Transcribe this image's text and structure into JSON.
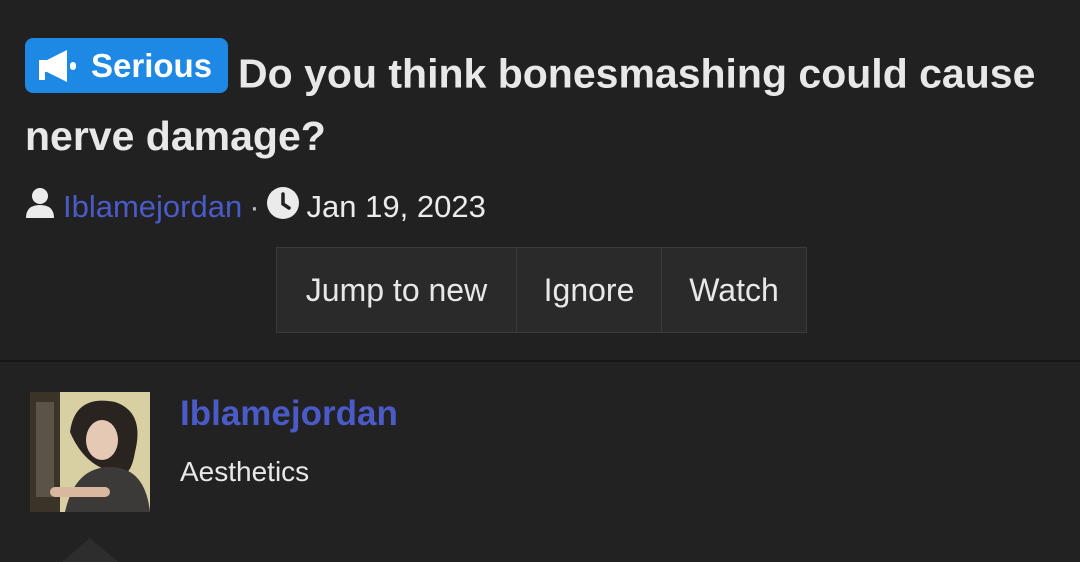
{
  "thread": {
    "prefix_label": "Serious",
    "title": "Do you think bonesmashing could cause nerve damage?",
    "author": "Iblamejordan",
    "separator": "·",
    "date": "Jan 19, 2023"
  },
  "actions": {
    "jump_label": "Jump to new",
    "ignore_label": "Ignore",
    "watch_label": "Watch"
  },
  "post": {
    "username": "Iblamejordan",
    "user_title": "Aesthetics"
  },
  "icons": {
    "prefix": "megaphone-icon",
    "author": "user-icon",
    "date": "clock-icon"
  },
  "colors": {
    "background": "#212121",
    "badge": "#1e88e5",
    "link": "#4a5ac7"
  }
}
